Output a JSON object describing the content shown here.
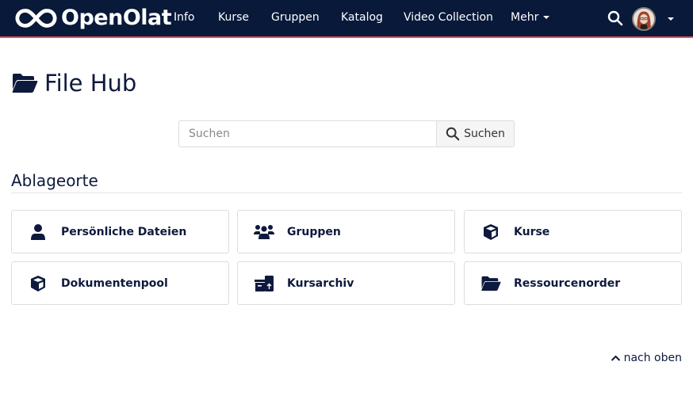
{
  "navbar": {
    "brand": "OpenOlat",
    "items": [
      {
        "label": "Info"
      },
      {
        "label": "Kurse"
      },
      {
        "label": "Gruppen"
      },
      {
        "label": "Katalog"
      },
      {
        "label": "Video Collection"
      },
      {
        "label": "Mehr",
        "has_dropdown": true
      }
    ],
    "search_icon": "search-icon",
    "user_menu_icon": "avatar"
  },
  "page": {
    "title": "File Hub",
    "title_icon": "folder-open-icon"
  },
  "search": {
    "placeholder": "Suchen",
    "value": "",
    "button_label": "Suchen"
  },
  "section": {
    "title": "Ablageorte",
    "tiles": [
      {
        "label": "Persönliche Dateien",
        "icon": "user-icon"
      },
      {
        "label": "Gruppen",
        "icon": "users-icon"
      },
      {
        "label": "Kurse",
        "icon": "cube-icon"
      },
      {
        "label": "Dokumentenpool",
        "icon": "cube-icon"
      },
      {
        "label": "Kursarchiv",
        "icon": "archive-icon"
      },
      {
        "label": "Ressourcenorder",
        "icon": "folder-open-icon"
      }
    ]
  },
  "footer": {
    "to_top_label": "nach oben"
  },
  "colors": {
    "navbar_bg": "#08193a",
    "navbar_accent": "#e2574c",
    "text_primary": "#0e1a3d"
  }
}
